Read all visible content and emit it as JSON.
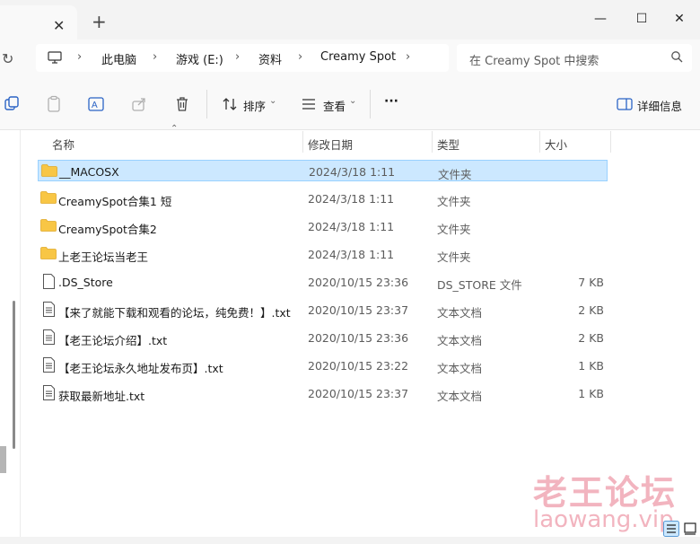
{
  "tabs": {
    "close_glyph": "✕",
    "new_tab_glyph": "+"
  },
  "window": {
    "minimize": "—",
    "maximize": "☐",
    "close": "✕"
  },
  "breadcrumb": {
    "items": [
      "此电脑",
      "游戏 (E:)",
      "资料",
      "Creamy Spot"
    ],
    "separator": "›"
  },
  "search": {
    "placeholder": "在 Creamy Spot 中搜索"
  },
  "toolbar": {
    "sort_label": "排序",
    "view_label": "查看",
    "more_label": "···",
    "details_label": "详细信息"
  },
  "columns": {
    "name": "名称",
    "date": "修改日期",
    "type": "类型",
    "size": "大小"
  },
  "files": [
    {
      "name": "__MACOSX",
      "date": "2024/3/18 1:11",
      "type": "文件夹",
      "size": "",
      "icon": "folder-icon",
      "selected": true
    },
    {
      "name": "CreamySpot合集1 短",
      "date": "2024/3/18 1:11",
      "type": "文件夹",
      "size": "",
      "icon": "folder-icon"
    },
    {
      "name": "CreamySpot合集2",
      "date": "2024/3/18 1:11",
      "type": "文件夹",
      "size": "",
      "icon": "folder-icon"
    },
    {
      "name": "上老王论坛当老王",
      "date": "2024/3/18 1:11",
      "type": "文件夹",
      "size": "",
      "icon": "folder-icon"
    },
    {
      "name": ".DS_Store",
      "date": "2020/10/15 23:36",
      "type": "DS_STORE 文件",
      "size": "7 KB",
      "icon": "file-icon"
    },
    {
      "name": "【来了就能下载和观看的论坛，纯免费！】.txt",
      "date": "2020/10/15 23:37",
      "type": "文本文档",
      "size": "2 KB",
      "icon": "text-file-icon"
    },
    {
      "name": "【老王论坛介绍】.txt",
      "date": "2020/10/15 23:36",
      "type": "文本文档",
      "size": "2 KB",
      "icon": "text-file-icon"
    },
    {
      "name": "【老王论坛永久地址发布页】.txt",
      "date": "2020/10/15 23:22",
      "type": "文本文档",
      "size": "1 KB",
      "icon": "text-file-icon"
    },
    {
      "name": "获取最新地址.txt",
      "date": "2020/10/15 23:37",
      "type": "文本文档",
      "size": "1 KB",
      "icon": "text-file-icon"
    }
  ],
  "watermark": {
    "text": "老王论坛",
    "url": "laowang.vip"
  },
  "colors": {
    "selection": "#cce8ff",
    "selection_border": "#99d1ff",
    "folder": "#f8c645",
    "watermark": "#f2b4bf"
  }
}
